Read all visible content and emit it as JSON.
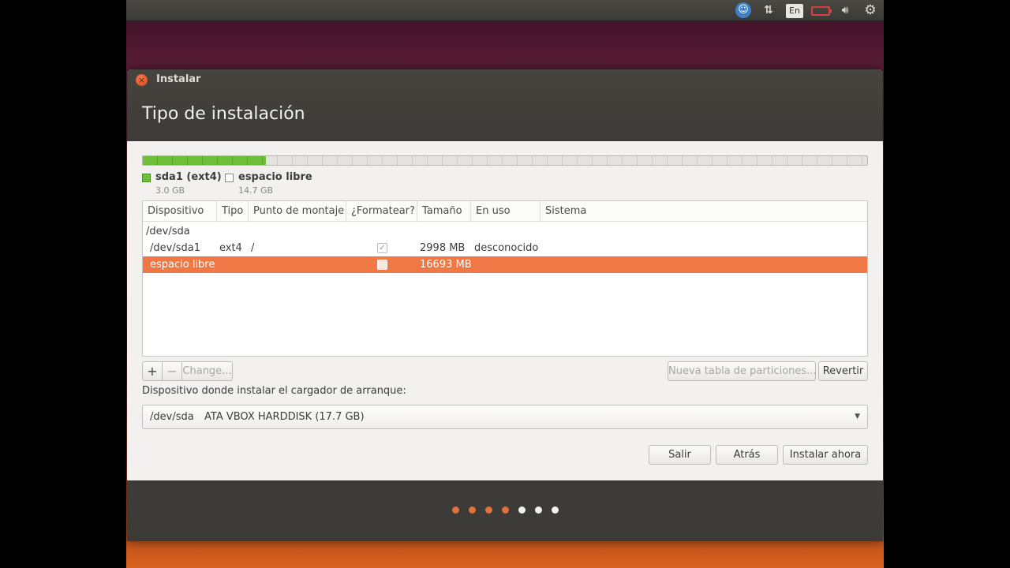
{
  "topbar": {
    "accessibility_icon": "accessibility-icon",
    "network_icon": "network-icon",
    "language": "En",
    "battery_icon": "battery-icon",
    "volume_icon": "volume-icon",
    "settings_icon": "gear-icon"
  },
  "window": {
    "title": "Instalar",
    "close_icon": "×",
    "page_title": "Tipo de instalación"
  },
  "disk_bar": {
    "used_fraction": 0.17,
    "used_color": "#6fbf3a"
  },
  "legend": [
    {
      "name": "sda1 (ext4)",
      "size": "3.0 GB",
      "color": "#6fbf3a"
    },
    {
      "name": "espacio libre",
      "size": "14.7 GB",
      "color": "#ffffff"
    }
  ],
  "table": {
    "columns": [
      "Dispositivo",
      "Tipo",
      "Punto de montaje",
      "¿Formatear?",
      "Tamaño",
      "En uso",
      "Sistema"
    ],
    "device_row": "/dev/sda",
    "rows": [
      {
        "device": "/dev/sda1",
        "type": "ext4",
        "mount": "/",
        "format": true,
        "size": "2998 MB",
        "used": "desconocido",
        "system": ""
      },
      {
        "device": "espacio libre",
        "type": "",
        "mount": "",
        "format": false,
        "size": "16693 MB",
        "used": "",
        "system": "",
        "selected": true
      }
    ],
    "selection_color": "#f07746"
  },
  "buttons": {
    "add": "+",
    "remove": "−",
    "change": "Change...",
    "new_table": "Nueva tabla de particiones...",
    "revert": "Revertir",
    "quit": "Salir",
    "back": "Atrás",
    "install": "Instalar ahora"
  },
  "bootloader": {
    "label": "Dispositivo donde instalar el cargador de arranque:",
    "device": "/dev/sda",
    "description": "ATA VBOX HARDDISK (17.7 GB)",
    "dropdown_icon": "▼"
  },
  "progress": {
    "total_steps": 7,
    "completed_steps": 4,
    "active_color": "#e0703c",
    "inactive_color": "#f2f1ef"
  }
}
